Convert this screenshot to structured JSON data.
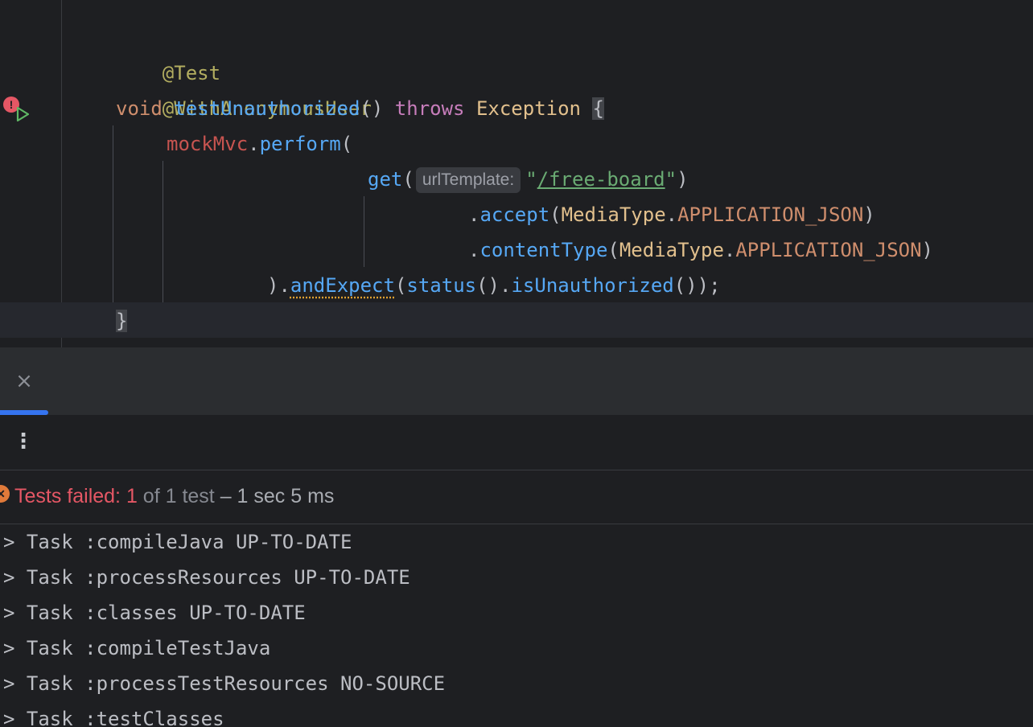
{
  "editor": {
    "annotation1": "@Test",
    "annotation2": "@WithAnonymousUser",
    "sig": {
      "void": "void",
      "method": "testUnauthorized",
      "parens": "()",
      "throws": "throws",
      "exception": "Exception",
      "brace": "{"
    },
    "l4": {
      "field": "mockMvc",
      "dot": ".",
      "method": "perform",
      "paren": "("
    },
    "l5": {
      "method": "get",
      "open": "(",
      "hint": "urlTemplate:",
      "q1": "\"",
      "path": "/free-board",
      "q2": "\"",
      "close": ")"
    },
    "l6": {
      "dot": ".",
      "method": "accept",
      "open": "(",
      "cls": "MediaType",
      "dot2": ".",
      "const": "APPLICATION_JSON",
      "close": ")"
    },
    "l7": {
      "dot": ".",
      "method": "contentType",
      "open": "(",
      "cls": "MediaType",
      "dot2": ".",
      "const": "APPLICATION_JSON",
      "close": ")"
    },
    "l8": {
      "start": ").",
      "method": "andExpect",
      "open": "(",
      "status": "status",
      "mid": "().",
      "unauth": "isUnauthorized",
      "end": "());"
    },
    "l9": "}"
  },
  "gutter": {
    "error_icon": "error-icon",
    "run_icon": "run-icon",
    "error_glyph": "!"
  },
  "toolwindow": {
    "close_glyph": "×",
    "more_glyph": "⋮",
    "status": {
      "failed_label": "Tests failed: 1",
      "of_label": " of 1 test ",
      "time_label": "– 1 sec 5 ms",
      "icon_glyph": "✕"
    },
    "console_lines": [
      "> Task :compileJava UP-TO-DATE",
      "> Task :processResources UP-TO-DATE",
      "> Task :classes UP-TO-DATE",
      "> Task :compileTestJava",
      "> Task :processTestResources NO-SOURCE",
      "> Task :testClasses"
    ]
  },
  "colors": {
    "editor_bg": "#1e1f22",
    "panel_bg": "#2b2d30",
    "accent": "#3574f0",
    "error": "#e55765",
    "annotation": "#b3ae60",
    "method": "#56a8f5",
    "string": "#6aab73"
  }
}
